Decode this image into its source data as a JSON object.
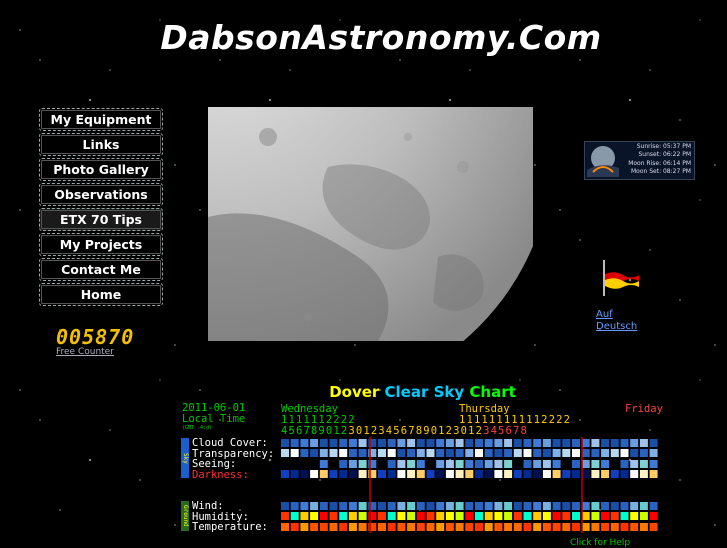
{
  "site": {
    "title": "DabsonAstronomy.Com"
  },
  "nav": [
    {
      "label": "My Equipment"
    },
    {
      "label": "Links"
    },
    {
      "label": "Photo Gallery"
    },
    {
      "label": "Observations"
    },
    {
      "label": "ETX 70 Tips"
    },
    {
      "label": "My Projects"
    },
    {
      "label": "Contact Me"
    },
    {
      "label": "Home"
    }
  ],
  "counter": {
    "value": "005870",
    "link_label": "Free Counter"
  },
  "sun_widget": {
    "lines": [
      "Sunrise:  05:37 PM",
      "Sunset:  06:22 PM",
      "Moon Rise:  06:14 PM",
      "Moon Set:  08:27 PM"
    ]
  },
  "language_link": {
    "label": "Auf Deutsch"
  },
  "flag_colors": [
    "#000000",
    "#dd0000",
    "#ffce00"
  ],
  "clear_sky_chart": {
    "title_parts": [
      "Dover",
      "Clear",
      "Sky",
      "Chart"
    ],
    "date": "2011-06-01",
    "local_time_label": "Local Time",
    "gmt_offset": "(GMT -4:d)",
    "days": [
      "Wednesday",
      "Thursday",
      "Friday"
    ],
    "hours_tens_row1": "1111112222",
    "hours_tens_row2": "111111111112222",
    "hours_digits": "456789012301234567890123012345678",
    "rows_sky": [
      "Cloud Cover:",
      "Transparency:",
      "Seeing:",
      "Darkness:"
    ],
    "rows_ground": [
      "Wind:",
      "Humidity:",
      "Temperature:"
    ],
    "sky_tag": "Sky",
    "ground_tag": "Ground",
    "footer": "Click for Help",
    "colors": {
      "label_green": "#00c800",
      "darkness_red": "#ff3030",
      "thursday": "#ffcc00",
      "friday": "#ff4040",
      "now_line": "#c00000"
    }
  }
}
